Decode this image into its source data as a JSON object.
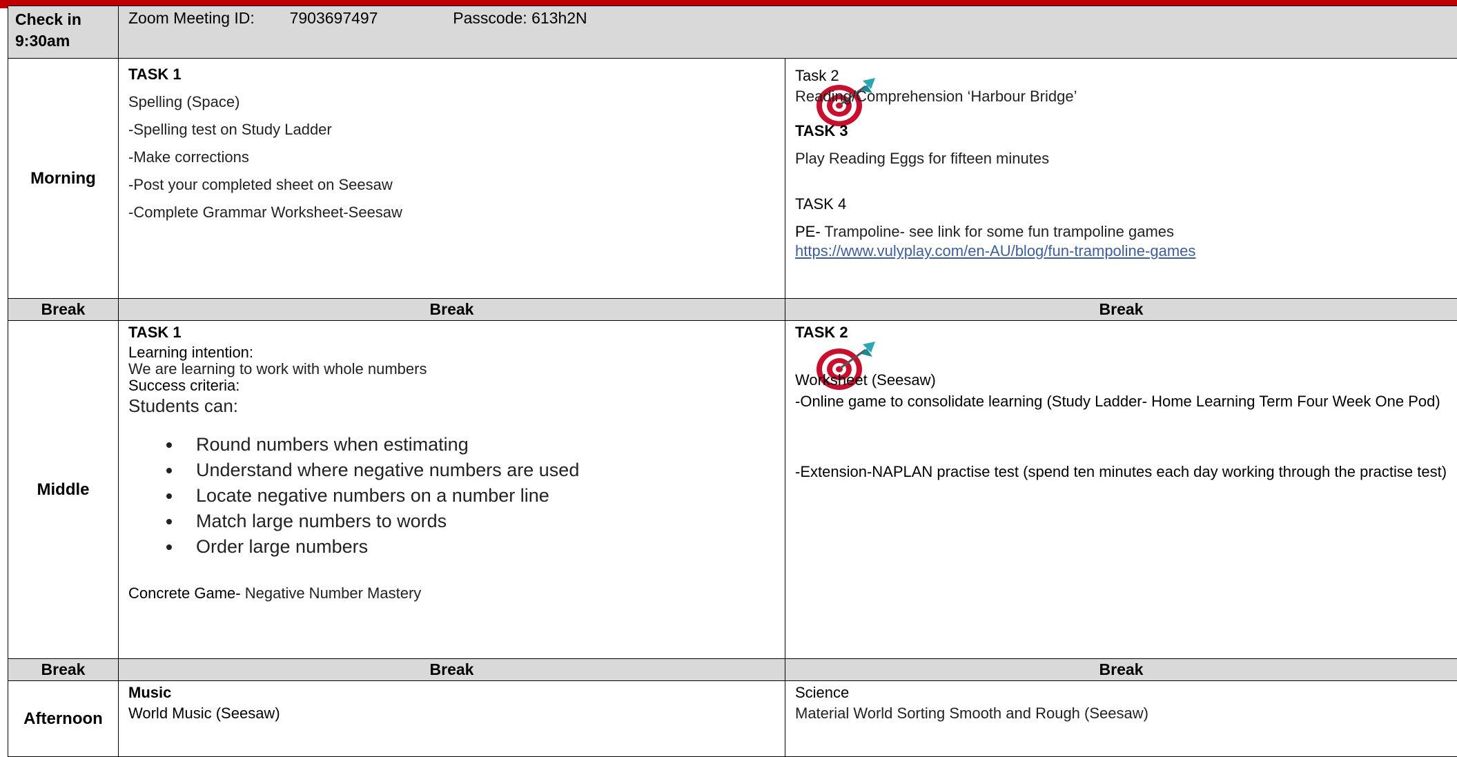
{
  "checkin": {
    "label": "Check in 9:30am",
    "zoom_label": "Zoom Meeting ID:",
    "zoom_id": "7903697497",
    "passcode": "Passcode: 613h2N"
  },
  "morning": {
    "label": "Morning",
    "left": {
      "heading": "TASK 1",
      "subject": "Spelling (Space)",
      "items": [
        "-Spelling test on Study Ladder",
        "-Make corrections",
        "-Post your completed sheet on Seesaw",
        "-Complete Grammar Worksheet-Seesaw"
      ]
    },
    "right": {
      "task2_heading": "Task 2",
      "task2_text": "Reading/Comprehension ‘Harbour Bridge’",
      "task3_heading": "TASK 3",
      "task3_text": "Play Reading Eggs for fifteen minutes",
      "task4_heading": "TASK 4",
      "pe_label": "PE-",
      "pe_text": " Trampoline- see link for some fun trampoline games",
      "link": "https://www.vulyplay.com/en-AU/blog/fun-trampoline-games"
    }
  },
  "break_label": "Break",
  "middle": {
    "label": "Middle",
    "left": {
      "heading": "TASK 1",
      "li_label": "Learning intention:",
      "li_text": "We are learning to work with whole numbers",
      "sc_label": "Success criteria:",
      "students_can": "Students can:",
      "criteria": [
        "Round numbers when estimating",
        "Understand where negative numbers are used",
        "Locate negative numbers on a number line",
        "Match large numbers to words",
        "Order large numbers"
      ],
      "game_label": "Concrete Game-",
      "game_text": " Negative Number Mastery"
    },
    "right": {
      "heading": "TASK 2",
      "worksheet": "Worksheet (Seesaw)",
      "online_game": "-Online game to consolidate learning (Study Ladder- Home Learning Term Four Week One Pod)",
      "extension": "-Extension-NAPLAN practise test (spend ten minutes each day working through the practise test)"
    }
  },
  "afternoon": {
    "label": "Afternoon",
    "left": {
      "heading": "Music",
      "text": "World Music (Seesaw)"
    },
    "right": {
      "heading": "Science",
      "text": "Material World Sorting Smooth and Rough (Seesaw)"
    }
  },
  "icons": {
    "task_target": "target-dart-icon"
  },
  "colors": {
    "header_bar": "#c00000",
    "row_gray": "#d9d9d9",
    "link": "#3c5f99"
  }
}
